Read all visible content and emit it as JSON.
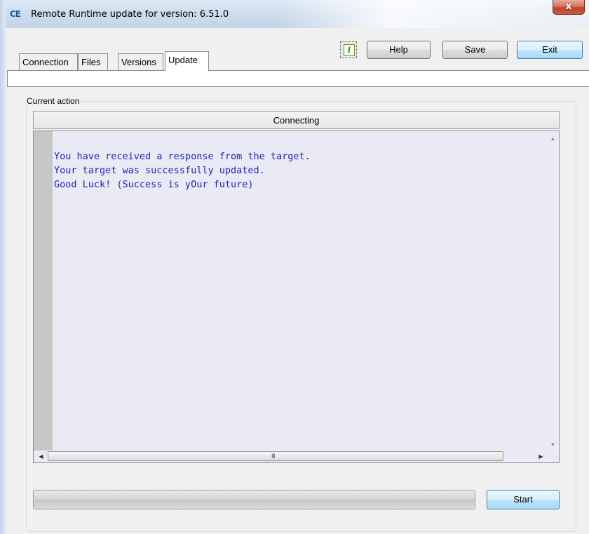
{
  "window": {
    "title": "Remote Runtime update for version: 6.51.0",
    "app_icon_text": "CE",
    "close_label": "x"
  },
  "tabs": [
    {
      "label": "Connection",
      "active": false
    },
    {
      "label": "Files",
      "active": false
    },
    {
      "label": "Versions",
      "active": false
    },
    {
      "label": "Update",
      "active": true
    }
  ],
  "toolbar": {
    "info_icon": "i",
    "help_label": "Help",
    "save_label": "Save",
    "exit_label": "Exit"
  },
  "current_action": {
    "group_label": "Current action",
    "status": "Connecting"
  },
  "log": {
    "lines": [
      "You have received a response from the target.",
      "Your target was successfully updated.",
      "Good Luck! (Success is yOur future)"
    ],
    "scroll_grip": "III"
  },
  "progress": {
    "value": 0
  },
  "actions": {
    "start_label": "Start"
  },
  "colors": {
    "log_text": "#2020cc",
    "log_background": "#eaeaf4",
    "default_button": "#bee6fd"
  }
}
